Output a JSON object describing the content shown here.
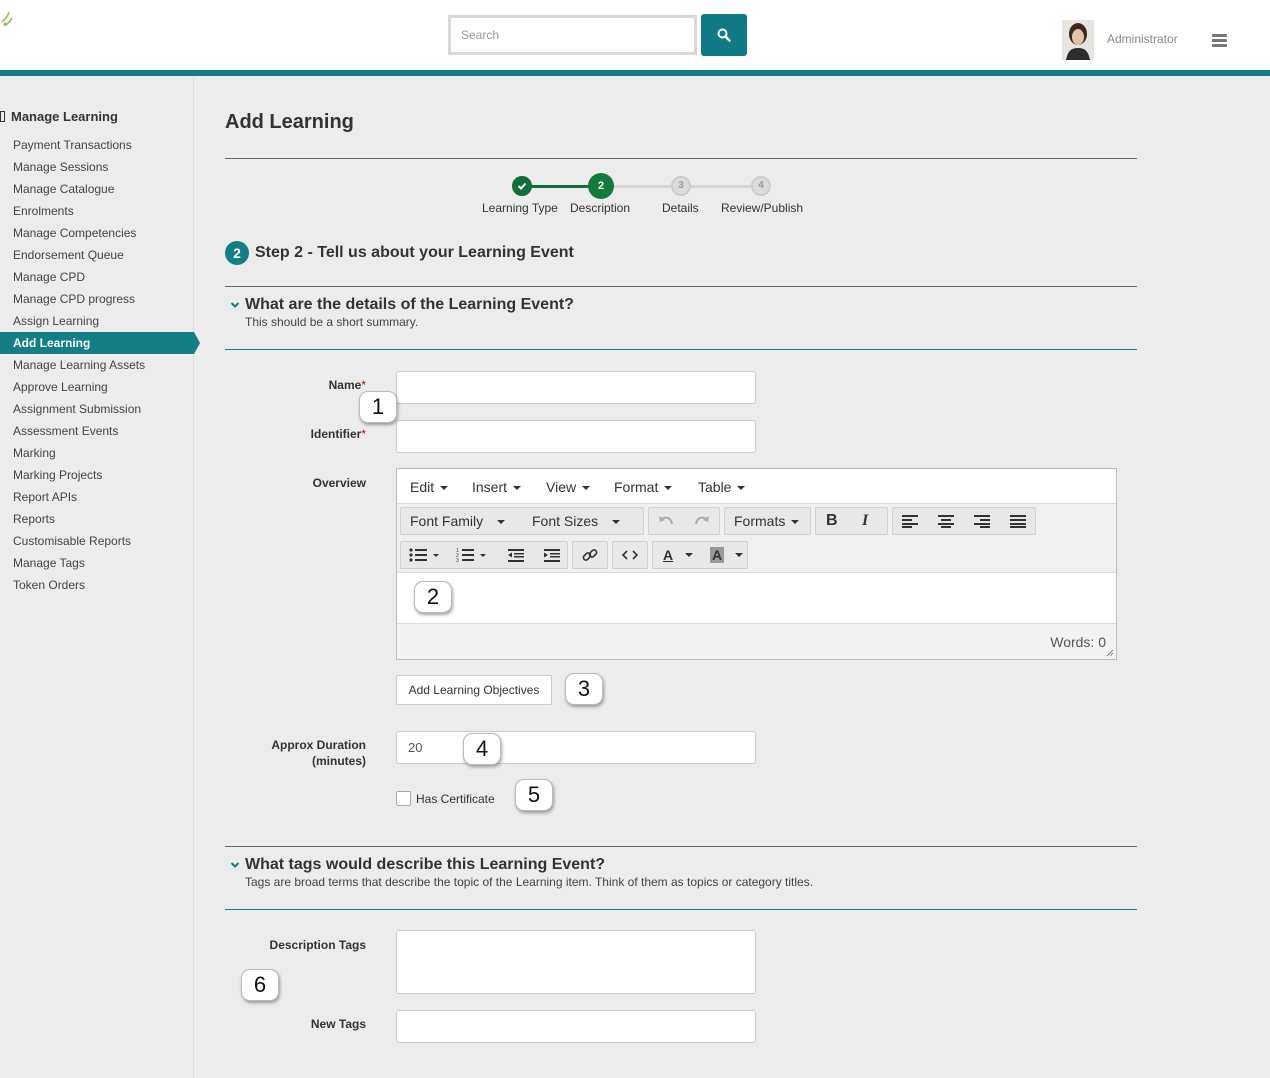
{
  "header": {
    "search_placeholder": "Search",
    "search_icon": "magnifier-icon",
    "user_name": "Administrator",
    "accent_color": "#137e85"
  },
  "sidebar": {
    "title": "Manage Learning",
    "items": [
      "Payment Transactions",
      "Manage Sessions",
      "Manage Catalogue",
      "Enrolments",
      "Manage Competencies",
      "Endorsement Queue",
      "Manage CPD",
      "Manage CPD progress",
      "Assign Learning",
      "Add Learning",
      "Manage Learning Assets",
      "Approve Learning",
      "Assignment Submission",
      "Assessment Events",
      "Marking",
      "Marking Projects",
      "Report APIs",
      "Reports",
      "Customisable Reports",
      "Manage Tags",
      "Token Orders"
    ],
    "active_item": "Add Learning"
  },
  "main": {
    "title": "Add Learning",
    "stepper": {
      "steps": [
        {
          "number": "",
          "label": "Learning Type",
          "state": "done"
        },
        {
          "number": "2",
          "label": "Description",
          "state": "current"
        },
        {
          "number": "3",
          "label": "Details",
          "state": "future"
        },
        {
          "number": "4",
          "label": "Review/Publish",
          "state": "future"
        }
      ]
    },
    "step_badge": "2",
    "step_heading": "Step 2 - Tell us about your Learning Event",
    "section1": {
      "title": "What are the details of the Learning Event?",
      "subtitle": "This should be a short summary."
    },
    "fields": {
      "name_label": "Name",
      "identifier_label": "Identifier",
      "required_mark": "*",
      "overview_label": "Overview",
      "duration_label_1": "Approx Duration",
      "duration_label_2": "(minutes)",
      "duration_value": "20",
      "certificate_label": "Has Certificate",
      "name_value": "",
      "identifier_value": ""
    },
    "editor": {
      "menus": [
        "Edit",
        "Insert",
        "View",
        "Format",
        "Table"
      ],
      "font_family": "Font Family",
      "font_sizes": "Font Sizes",
      "formats": "Formats",
      "bold": "B",
      "italic": "I",
      "text_color": "A",
      "bg_color": "A",
      "word_count": "Words: 0"
    },
    "objectives_button": "Add Learning Objectives",
    "section2": {
      "title": "What tags would describe this Learning Event?",
      "subtitle": "Tags are broad terms that describe the topic of the Learning item. Think of them as topics or category titles."
    },
    "tags": {
      "description_label": "Description Tags",
      "new_label": "New Tags"
    },
    "callouts": [
      "1",
      "2",
      "3",
      "4",
      "5",
      "6"
    ]
  }
}
